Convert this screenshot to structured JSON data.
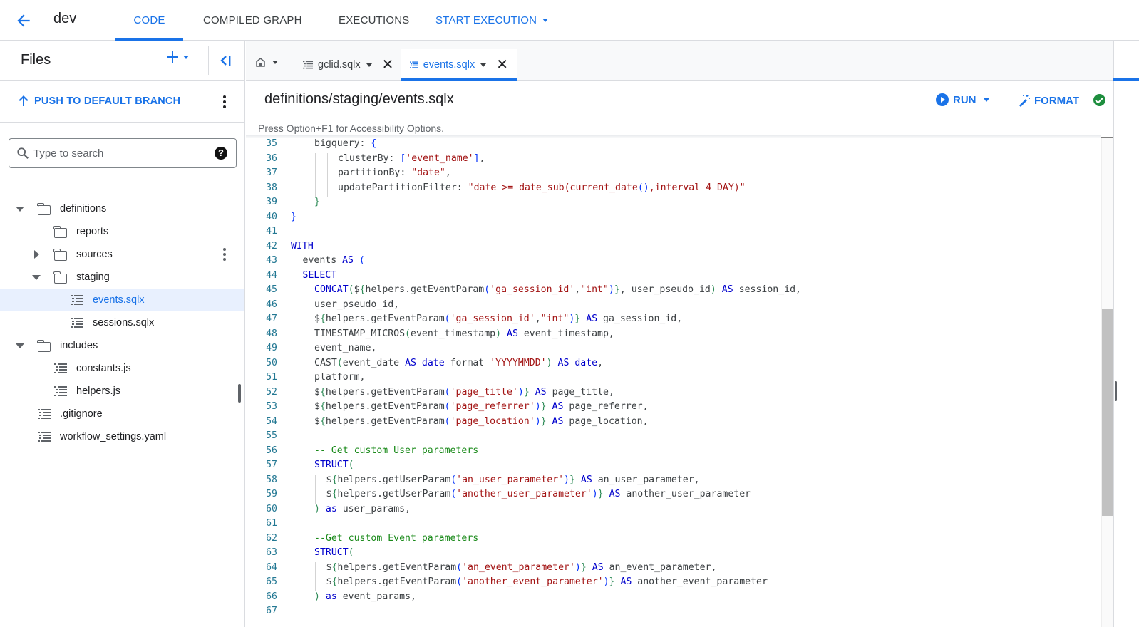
{
  "topbar": {
    "workspace": "dev",
    "tabs": [
      {
        "label": "CODE",
        "active": true
      },
      {
        "label": "COMPILED GRAPH",
        "active": false
      },
      {
        "label": "EXECUTIONS",
        "active": false
      },
      {
        "label": "START EXECUTION",
        "active": false,
        "dropdown": true
      }
    ]
  },
  "sidebar": {
    "title": "Files",
    "push_label": "PUSH TO DEFAULT BRANCH",
    "search_placeholder": "Type to search",
    "help_glyph": "?",
    "tree": [
      {
        "label": "definitions",
        "type": "folder",
        "expanded": true,
        "depth": 0
      },
      {
        "label": "reports",
        "type": "folder",
        "expanded": null,
        "depth": 1
      },
      {
        "label": "sources",
        "type": "folder",
        "expanded": false,
        "depth": 1
      },
      {
        "label": "staging",
        "type": "folder",
        "expanded": true,
        "depth": 1
      },
      {
        "label": "events.sqlx",
        "type": "file",
        "depth": 2,
        "selected": true
      },
      {
        "label": "sessions.sqlx",
        "type": "file",
        "depth": 2
      },
      {
        "label": "includes",
        "type": "folder",
        "expanded": true,
        "depth": 0
      },
      {
        "label": "constants.js",
        "type": "file",
        "depth": 1
      },
      {
        "label": "helpers.js",
        "type": "file",
        "depth": 1
      },
      {
        "label": ".gitignore",
        "type": "file",
        "depth": 0
      },
      {
        "label": "workflow_settings.yaml",
        "type": "file",
        "depth": 0
      }
    ]
  },
  "editor": {
    "tabs": [
      {
        "label": "gclid.sqlx",
        "active": false
      },
      {
        "label": "events.sqlx",
        "active": true
      }
    ],
    "close_glyph": "✕",
    "path": "definitions/staging/events.sqlx",
    "run_label": "RUN",
    "format_label": "FORMAT",
    "status": "compiled-ok",
    "a11y_hint": "Press Option+F1 for Accessibility Options.",
    "lines": [
      {
        "n": "35",
        "indent": 2,
        "tokens": [
          [
            "t",
            "bigquery: "
          ],
          [
            "br",
            "{"
          ]
        ]
      },
      {
        "n": "36",
        "indent": 4,
        "tokens": [
          [
            "t",
            "clusterBy: "
          ],
          [
            "br",
            "["
          ],
          [
            "s",
            "'event_name'"
          ],
          [
            "br",
            "]"
          ],
          [
            "t",
            ","
          ]
        ]
      },
      {
        "n": "37",
        "indent": 4,
        "tokens": [
          [
            "t",
            "partitionBy: "
          ],
          [
            "s",
            "\"date\""
          ],
          [
            "t",
            ","
          ]
        ]
      },
      {
        "n": "38",
        "indent": 4,
        "tokens": [
          [
            "t",
            "updatePartitionFilter: "
          ],
          [
            "s",
            "\"date >= date_sub(current_date"
          ],
          [
            "br",
            "()"
          ],
          [
            "s",
            ",interval 4 DAY)\""
          ]
        ]
      },
      {
        "n": "39",
        "indent": 2,
        "tokens": [
          [
            "p",
            "}"
          ]
        ]
      },
      {
        "n": "40",
        "indent": 0,
        "tokens": [
          [
            "br",
            "}"
          ]
        ]
      },
      {
        "n": "41",
        "indent": 0,
        "tokens": []
      },
      {
        "n": "42",
        "indent": 0,
        "tokens": [
          [
            "k",
            "WITH"
          ]
        ]
      },
      {
        "n": "43",
        "indent": 1,
        "tokens": [
          [
            "t",
            "events "
          ],
          [
            "k",
            "AS"
          ],
          [
            "t",
            " "
          ],
          [
            "br",
            "("
          ]
        ]
      },
      {
        "n": "44",
        "indent": 1,
        "tokens": [
          [
            "k",
            "SELECT"
          ]
        ]
      },
      {
        "n": "45",
        "indent": 2,
        "tokens": [
          [
            "k",
            "CONCAT"
          ],
          [
            "p",
            "("
          ],
          [
            "t",
            "$"
          ],
          [
            "p",
            "{"
          ],
          [
            "t",
            "helpers.getEventParam"
          ],
          [
            "br",
            "("
          ],
          [
            "s",
            "'ga_session_id'"
          ],
          [
            "t",
            ","
          ],
          [
            "s",
            "\"int\""
          ],
          [
            "br",
            ")"
          ],
          [
            "p",
            "}"
          ],
          [
            "t",
            ", user_pseudo_id"
          ],
          [
            "p",
            ")"
          ],
          [
            "t",
            " "
          ],
          [
            "k",
            "AS"
          ],
          [
            "t",
            " session_id,"
          ]
        ]
      },
      {
        "n": "46",
        "indent": 2,
        "tokens": [
          [
            "t",
            "user_pseudo_id,"
          ]
        ]
      },
      {
        "n": "47",
        "indent": 2,
        "tokens": [
          [
            "t",
            "$"
          ],
          [
            "p",
            "{"
          ],
          [
            "t",
            "helpers.getEventParam"
          ],
          [
            "br",
            "("
          ],
          [
            "s",
            "'ga_session_id'"
          ],
          [
            "t",
            ","
          ],
          [
            "s",
            "\"int\""
          ],
          [
            "br",
            ")"
          ],
          [
            "p",
            "}"
          ],
          [
            "t",
            " "
          ],
          [
            "k",
            "AS"
          ],
          [
            "t",
            " ga_session_id,"
          ]
        ]
      },
      {
        "n": "48",
        "indent": 2,
        "tokens": [
          [
            "t",
            "TIMESTAMP_MICROS"
          ],
          [
            "p",
            "("
          ],
          [
            "t",
            "event_timestamp"
          ],
          [
            "p",
            ")"
          ],
          [
            "t",
            " "
          ],
          [
            "k",
            "AS"
          ],
          [
            "t",
            " event_timestamp,"
          ]
        ]
      },
      {
        "n": "49",
        "indent": 2,
        "tokens": [
          [
            "t",
            "event_name,"
          ]
        ]
      },
      {
        "n": "50",
        "indent": 2,
        "tokens": [
          [
            "t",
            "CAST"
          ],
          [
            "p",
            "("
          ],
          [
            "t",
            "event_date "
          ],
          [
            "k",
            "AS"
          ],
          [
            "t",
            " "
          ],
          [
            "k",
            "date"
          ],
          [
            "t",
            " format "
          ],
          [
            "s",
            "'YYYYMMDD'"
          ],
          [
            "p",
            ")"
          ],
          [
            "t",
            " "
          ],
          [
            "k",
            "AS"
          ],
          [
            "t",
            " "
          ],
          [
            "k",
            "date"
          ],
          [
            "t",
            ","
          ]
        ]
      },
      {
        "n": "51",
        "indent": 2,
        "tokens": [
          [
            "t",
            "platform,"
          ]
        ]
      },
      {
        "n": "52",
        "indent": 2,
        "tokens": [
          [
            "t",
            "$"
          ],
          [
            "p",
            "{"
          ],
          [
            "t",
            "helpers.getEventParam"
          ],
          [
            "br",
            "("
          ],
          [
            "s",
            "'page_title'"
          ],
          [
            "br",
            ")"
          ],
          [
            "p",
            "}"
          ],
          [
            "t",
            " "
          ],
          [
            "k",
            "AS"
          ],
          [
            "t",
            " page_title,"
          ]
        ]
      },
      {
        "n": "53",
        "indent": 2,
        "tokens": [
          [
            "t",
            "$"
          ],
          [
            "p",
            "{"
          ],
          [
            "t",
            "helpers.getEventParam"
          ],
          [
            "br",
            "("
          ],
          [
            "s",
            "'page_referrer'"
          ],
          [
            "br",
            ")"
          ],
          [
            "p",
            "}"
          ],
          [
            "t",
            " "
          ],
          [
            "k",
            "AS"
          ],
          [
            "t",
            " page_referrer,"
          ]
        ]
      },
      {
        "n": "54",
        "indent": 2,
        "tokens": [
          [
            "t",
            "$"
          ],
          [
            "p",
            "{"
          ],
          [
            "t",
            "helpers.getEventParam"
          ],
          [
            "br",
            "("
          ],
          [
            "s",
            "'page_location'"
          ],
          [
            "br",
            ")"
          ],
          [
            "p",
            "}"
          ],
          [
            "t",
            " "
          ],
          [
            "k",
            "AS"
          ],
          [
            "t",
            " page_location,"
          ]
        ]
      },
      {
        "n": "55",
        "indent": 2,
        "tokens": []
      },
      {
        "n": "56",
        "indent": 2,
        "tokens": [
          [
            "c",
            "-- Get custom User parameters"
          ]
        ]
      },
      {
        "n": "57",
        "indent": 2,
        "tokens": [
          [
            "k",
            "STRUCT"
          ],
          [
            "p",
            "("
          ]
        ]
      },
      {
        "n": "58",
        "indent": 3,
        "tokens": [
          [
            "t",
            "$"
          ],
          [
            "p",
            "{"
          ],
          [
            "t",
            "helpers.getUserParam"
          ],
          [
            "br",
            "("
          ],
          [
            "s",
            "'an_user_parameter'"
          ],
          [
            "br",
            ")"
          ],
          [
            "p",
            "}"
          ],
          [
            "t",
            " "
          ],
          [
            "k",
            "AS"
          ],
          [
            "t",
            " an_user_parameter,"
          ]
        ]
      },
      {
        "n": "59",
        "indent": 3,
        "tokens": [
          [
            "t",
            "$"
          ],
          [
            "p",
            "{"
          ],
          [
            "t",
            "helpers.getUserParam"
          ],
          [
            "br",
            "("
          ],
          [
            "s",
            "'another_user_parameter'"
          ],
          [
            "br",
            ")"
          ],
          [
            "p",
            "}"
          ],
          [
            "t",
            " "
          ],
          [
            "k",
            "AS"
          ],
          [
            "t",
            " another_user_parameter"
          ]
        ]
      },
      {
        "n": "60",
        "indent": 2,
        "tokens": [
          [
            "p",
            ")"
          ],
          [
            "t",
            " "
          ],
          [
            "k",
            "as"
          ],
          [
            "t",
            " user_params,"
          ]
        ]
      },
      {
        "n": "61",
        "indent": 2,
        "tokens": []
      },
      {
        "n": "62",
        "indent": 2,
        "tokens": [
          [
            "c",
            "--Get custom Event parameters"
          ]
        ]
      },
      {
        "n": "63",
        "indent": 2,
        "tokens": [
          [
            "k",
            "STRUCT"
          ],
          [
            "p",
            "("
          ]
        ]
      },
      {
        "n": "64",
        "indent": 3,
        "tokens": [
          [
            "t",
            "$"
          ],
          [
            "p",
            "{"
          ],
          [
            "t",
            "helpers.getEventParam"
          ],
          [
            "br",
            "("
          ],
          [
            "s",
            "'an_event_parameter'"
          ],
          [
            "br",
            ")"
          ],
          [
            "p",
            "}"
          ],
          [
            "t",
            " "
          ],
          [
            "k",
            "AS"
          ],
          [
            "t",
            " an_event_parameter,"
          ]
        ]
      },
      {
        "n": "65",
        "indent": 3,
        "tokens": [
          [
            "t",
            "$"
          ],
          [
            "p",
            "{"
          ],
          [
            "t",
            "helpers.getEventParam"
          ],
          [
            "br",
            "("
          ],
          [
            "s",
            "'another_event_parameter'"
          ],
          [
            "br",
            ")"
          ],
          [
            "p",
            "}"
          ],
          [
            "t",
            " "
          ],
          [
            "k",
            "AS"
          ],
          [
            "t",
            " another_event_parameter"
          ]
        ]
      },
      {
        "n": "66",
        "indent": 2,
        "tokens": [
          [
            "p",
            ")"
          ],
          [
            "t",
            " "
          ],
          [
            "k",
            "as"
          ],
          [
            "t",
            " event_params,"
          ]
        ]
      },
      {
        "n": "67",
        "indent": 2,
        "tokens": []
      }
    ]
  },
  "colors": {
    "accent": "#1a73e8",
    "selected_bg": "#e8f0fe",
    "ok_green": "#1e8e3e",
    "keyword": "#0000cc",
    "string": "#a31515",
    "comment": "#1a8a1a",
    "line_number": "#237893"
  }
}
